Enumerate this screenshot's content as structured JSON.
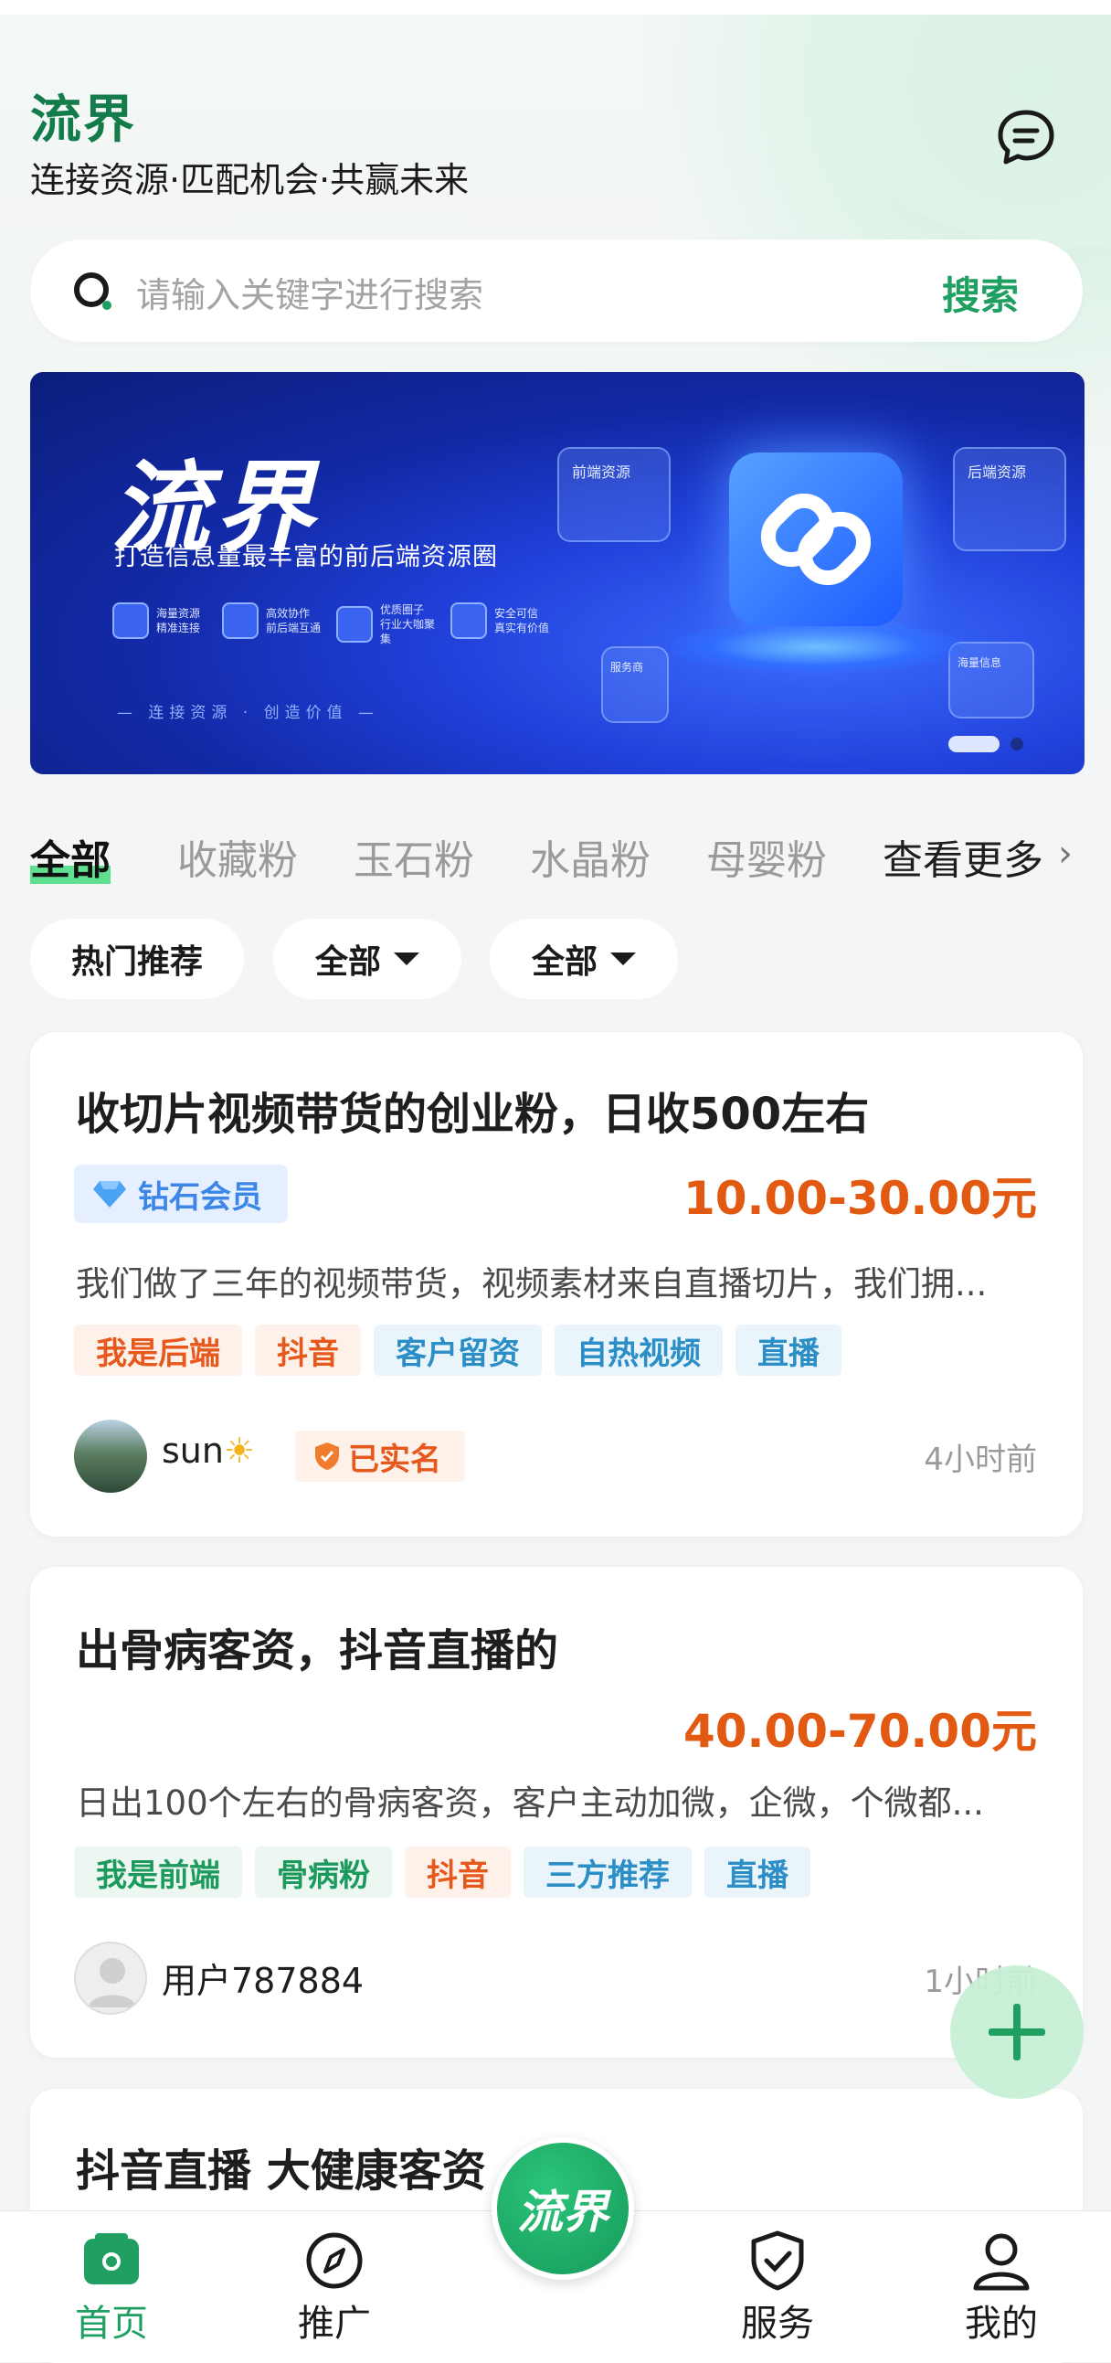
{
  "header": {
    "brand": "流界",
    "slogan": "连接资源·匹配机会·共赢未来"
  },
  "search": {
    "placeholder": "请输入关键字进行搜索",
    "button": "搜索"
  },
  "banner": {
    "title": "流界",
    "subtitle": "打造信息量最丰富的前后端资源圈",
    "features": [
      {
        "title": "海量资源",
        "sub": "精准连接"
      },
      {
        "title": "高效协作",
        "sub": "前后端互通"
      },
      {
        "title": "优质圈子",
        "sub": "行业大咖聚集"
      },
      {
        "title": "安全可信",
        "sub": "真实有价值"
      }
    ],
    "tagline": "— 连接资源 · 创造价值 —",
    "panels": {
      "front": "前端资源",
      "back": "后端资源",
      "service": "服务商",
      "data": "海量信息"
    }
  },
  "categories": {
    "items": [
      "全部",
      "收藏粉",
      "玉石粉",
      "水晶粉",
      "母婴粉"
    ],
    "more": "查看更多"
  },
  "filters": [
    "热门推荐",
    "全部",
    "全部"
  ],
  "listings": [
    {
      "title": "收切片视频带货的创业粉，日收500左右",
      "badge": "钻石会员",
      "price": "10.00-30.00元",
      "desc": "我们做了三年的视频带货，视频素材来自直播切片，我们拥...",
      "tags": [
        "我是后端",
        "抖音",
        "客户留资",
        "自热视频",
        "直播"
      ],
      "user": "sun",
      "verified": "已实名",
      "time": "4小时前"
    },
    {
      "title": "出骨病客资，抖音直播的",
      "price": "40.00-70.00元",
      "desc": "日出100个左右的骨病客资，客户主动加微，企微，个微都...",
      "tags": [
        "我是前端",
        "骨病粉",
        "抖音",
        "三方推荐",
        "直播"
      ],
      "user": "用户787884",
      "time": "1小时前"
    },
    {
      "title": "抖音直播 大健康客资"
    }
  ],
  "tabbar": {
    "home": "首页",
    "promote": "推广",
    "center": "流界",
    "service": "服务",
    "mine": "我的"
  }
}
